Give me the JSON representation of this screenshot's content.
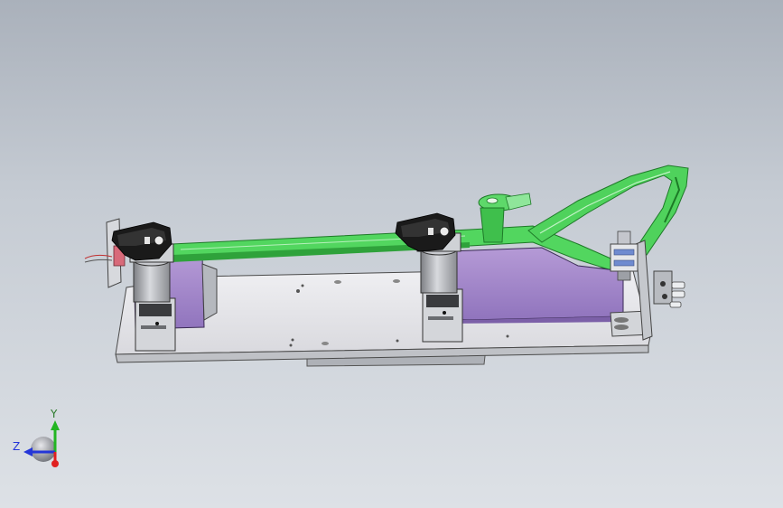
{
  "viewport": {
    "background_top": "#aab1bb",
    "background_bottom": "#dde1e6"
  },
  "model": {
    "colors": {
      "base_plate": "#e6e6ea",
      "lower_rail": "#b9bcc2",
      "fixture_arm": "#4cd45a",
      "fixture_arm_dark": "#1e8a2a",
      "support_block": "#a58ac9",
      "clamp_body": "#cfd2d6",
      "clamp_head": "#151515"
    }
  },
  "triad": {
    "y_label": "Y",
    "z_label": "Z",
    "colors": {
      "x": "#e02020",
      "y": "#22b522",
      "z": "#2436d8"
    },
    "icons": {
      "center": "triad-sphere-icon"
    }
  }
}
